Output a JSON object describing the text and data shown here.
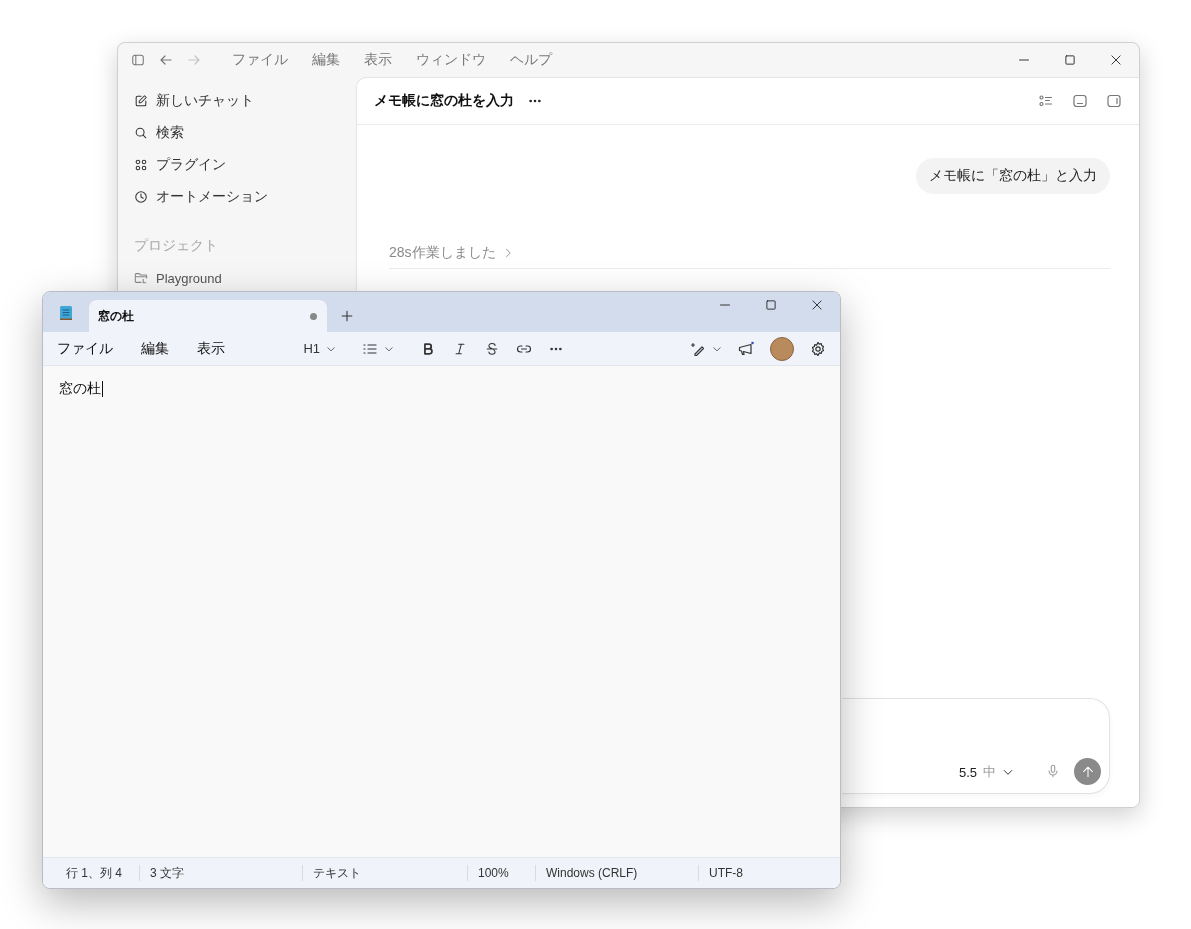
{
  "chat_window": {
    "menu": [
      "ファイル",
      "編集",
      "表示",
      "ウィンドウ",
      "ヘルプ"
    ],
    "sidebar": {
      "items": [
        {
          "label": "新しいチャット",
          "kind": "compose"
        },
        {
          "label": "検索",
          "kind": "search"
        },
        {
          "label": "プラグイン",
          "kind": "plugins"
        },
        {
          "label": "オートメーション",
          "kind": "clock"
        }
      ],
      "section_title": "プロジェクト",
      "projects": [
        {
          "label": "Playground"
        }
      ]
    },
    "thread": {
      "title": "メモ帳に窓の杜を入力",
      "messages": [
        {
          "text": "メモ帳に「窓の杜」と入力"
        }
      ],
      "work_summary": "28s作業しました"
    },
    "composer": {
      "model": "5.5",
      "effort": "中"
    }
  },
  "notepad": {
    "tabs": [
      {
        "label": "窓の杜",
        "selected": true,
        "modified": true
      }
    ],
    "menu": [
      "ファイル",
      "編集",
      "表示"
    ],
    "heading_dropdown": "H1",
    "content": "窓の杜",
    "status_bar": [
      "行 1、列 4",
      "3 文字",
      "テキスト",
      "100%",
      "Windows (CRLF)",
      "UTF-8"
    ]
  }
}
